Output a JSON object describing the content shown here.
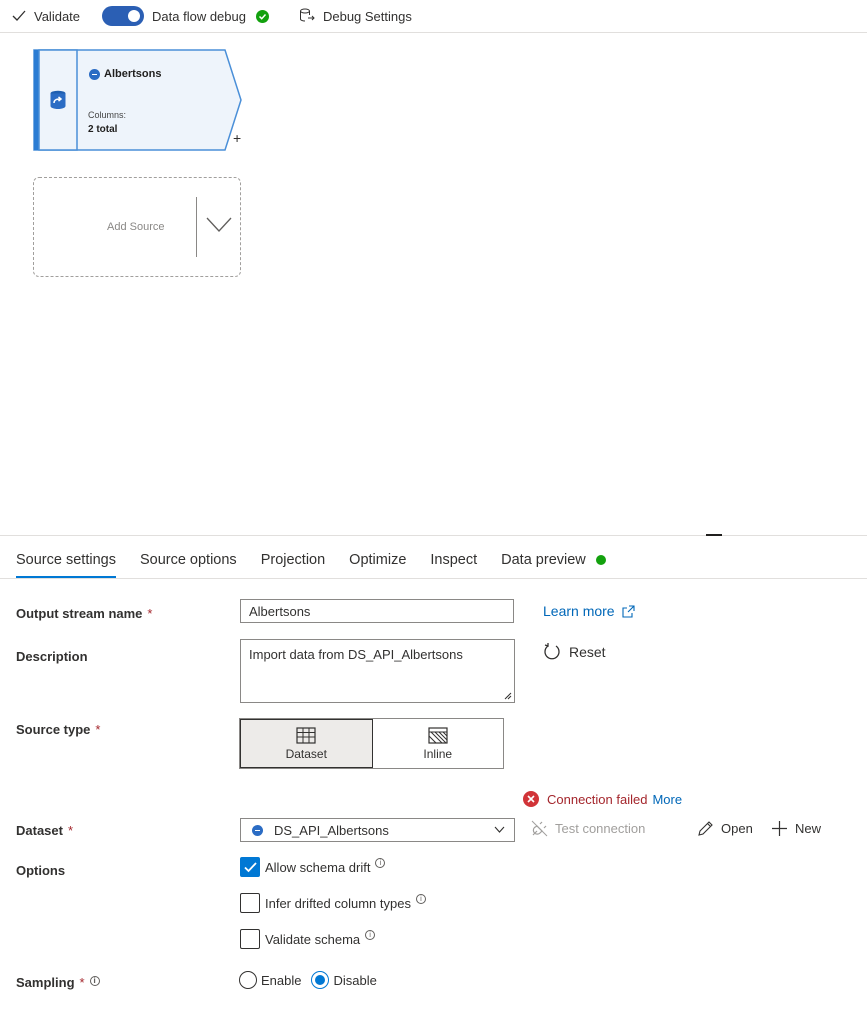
{
  "toolbar": {
    "validate_label": "Validate",
    "debug_label": "Data flow debug",
    "debug_enabled": true,
    "debug_settings_label": "Debug Settings"
  },
  "canvas": {
    "source_node": {
      "title": "Albertsons",
      "columns_label": "Columns:",
      "columns_value": "2 total",
      "plus": "+"
    },
    "add_source_label": "Add Source"
  },
  "tabs": [
    {
      "label": "Source settings",
      "active": true
    },
    {
      "label": "Source options"
    },
    {
      "label": "Projection"
    },
    {
      "label": "Optimize"
    },
    {
      "label": "Inspect"
    },
    {
      "label": "Data preview",
      "status": "green"
    }
  ],
  "form": {
    "output_stream": {
      "label": "Output stream name",
      "required": "*",
      "value": "Albertsons"
    },
    "learn_more": "Learn more",
    "description": {
      "label": "Description",
      "value": "Import data from DS_API_Albertsons"
    },
    "reset": "Reset",
    "source_type": {
      "label": "Source type",
      "required": "*",
      "options": [
        "Dataset",
        "Inline"
      ],
      "selected": "Dataset"
    },
    "connection": {
      "message": "Connection failed",
      "more": "More"
    },
    "dataset": {
      "label": "Dataset",
      "required": "*",
      "value": "DS_API_Albertsons"
    },
    "actions": {
      "test_connection": "Test connection",
      "open": "Open",
      "new": "New"
    },
    "options": {
      "label": "Options",
      "allow_schema_drift": {
        "label": "Allow schema drift",
        "checked": true
      },
      "infer_drifted": {
        "label": "Infer drifted column types",
        "checked": false
      },
      "validate_schema": {
        "label": "Validate schema",
        "checked": false
      }
    },
    "sampling": {
      "label": "Sampling",
      "required": "*",
      "enable": "Enable",
      "disable": "Disable",
      "selected": "Disable"
    },
    "info_glyph": "i"
  },
  "colors": {
    "accent": "#0078d4",
    "error": "#a4262c",
    "success": "#13a10e"
  }
}
